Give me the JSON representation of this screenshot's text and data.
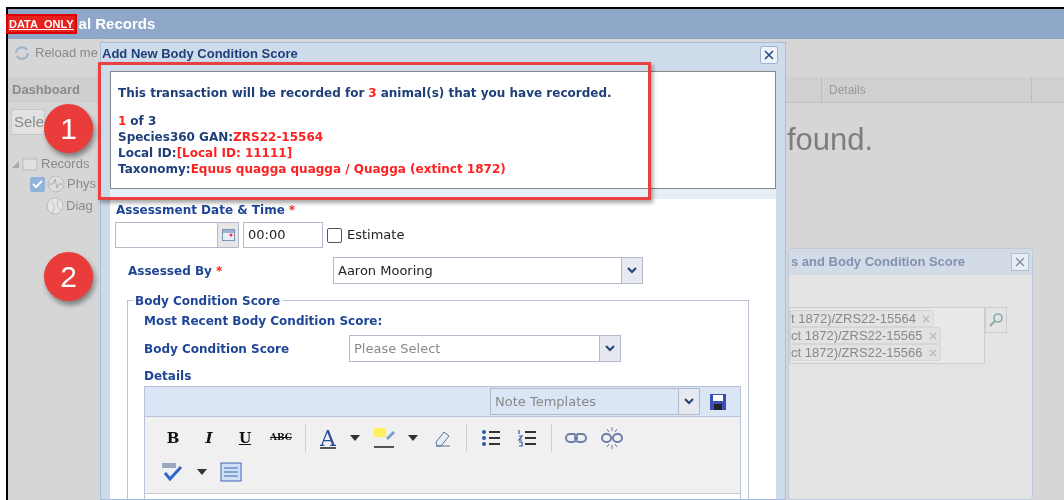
{
  "redaction_label": "DATA_ONLY",
  "app": {
    "title": "al Records",
    "toolbar_button": "Reload me",
    "sidebar": {
      "tab": "Dashboard",
      "search_placeholder": "Sele",
      "tree": [
        {
          "label": "Records",
          "expanded": true,
          "children": [
            {
              "kind": "checkbox",
              "label": "Phys",
              "checked": true
            },
            {
              "kind": "item",
              "label": "Diag"
            }
          ]
        }
      ]
    },
    "grid": {
      "columns": [
        "Details"
      ],
      "empty_text": "found."
    }
  },
  "background_dialog": {
    "title": "s and Body Condition Score",
    "selected_animals": [
      {
        "label": "t 1872)/ZRS22-15564"
      },
      {
        "label": "ct 1872)/ZRS22-15565"
      },
      {
        "label": "ct 1872)/ZRS22-15566"
      }
    ]
  },
  "dialog": {
    "title": "Add New Body Condition Score",
    "info": {
      "summary_before": "This transaction will be recorded for",
      "count": "3",
      "summary_after": "animal(s) that you have recorded.",
      "position_current": "1",
      "position_rest": "of 3",
      "fields": [
        {
          "label": "Species360 GAN:",
          "value": "ZRS22-15564"
        },
        {
          "label": "Local ID:",
          "value": "[Local ID: 11111]"
        },
        {
          "label": "Taxonomy:",
          "value": "Equus quagga quagga / Quagga (extinct 1872)"
        }
      ]
    },
    "assessment": {
      "label": "Assessment Date & Time",
      "required_mark": "*",
      "time": "00:00",
      "estimate": {
        "label": "Estimate",
        "checked": false
      }
    },
    "assessed_by": {
      "label": "Assessed By",
      "required_mark": "*",
      "value": "Aaron Mooring"
    },
    "body_condition": {
      "legend": "Body Condition Score",
      "most_recent_label": "Most Recent Body Condition Score:",
      "score_label": "Body Condition Score",
      "score_placeholder": "Please Select",
      "details_label": "Details",
      "note_templates_placeholder": "Note Templates",
      "toolbar": [
        {
          "kind": "bold",
          "label": "B"
        },
        {
          "kind": "italic",
          "label": "I"
        },
        {
          "kind": "underline",
          "label": "U"
        },
        {
          "kind": "strike",
          "label": "ABC"
        },
        {
          "kind": "separator"
        },
        {
          "kind": "font-color",
          "label": "A"
        },
        {
          "kind": "dropdown"
        },
        {
          "kind": "highlight"
        },
        {
          "kind": "dropdown"
        },
        {
          "kind": "eraser"
        },
        {
          "kind": "separator"
        },
        {
          "kind": "bullets"
        },
        {
          "kind": "numbers"
        },
        {
          "kind": "separator"
        },
        {
          "kind": "link"
        },
        {
          "kind": "unlink"
        },
        {
          "kind": "break"
        },
        {
          "kind": "spellcheck"
        },
        {
          "kind": "dropdown"
        },
        {
          "kind": "source"
        }
      ]
    }
  },
  "annotations": [
    {
      "number": "1"
    },
    {
      "number": "2"
    }
  ]
}
